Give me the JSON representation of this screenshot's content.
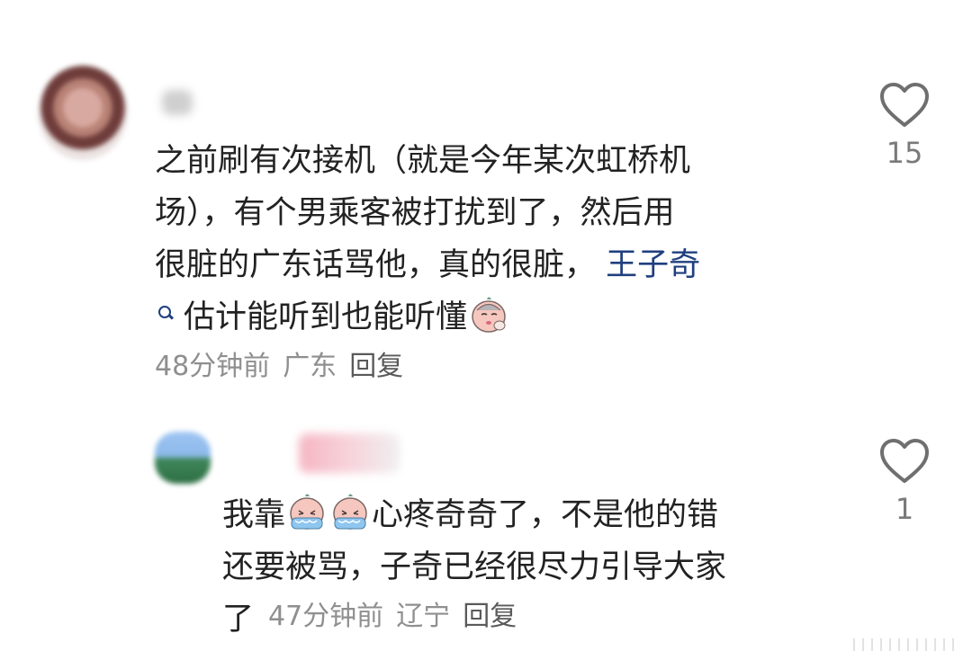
{
  "comments": [
    {
      "text_lines": [
        "之前刷有次接机（就是今年某次虹桥机",
        "场），有个男乘客被打扰到了，然后用",
        "很脏的广东话骂他，真的很脏，"
      ],
      "mention": "王子奇",
      "tail_text": "估计能听到也能听懂",
      "time": "48分钟前",
      "location": "广东",
      "reply_label": "回复",
      "like_count": "15",
      "emoji_name": "sad-face-emoji"
    },
    {
      "prefix": "我靠",
      "middle": "心疼奇奇了，不是他的错",
      "line2": "还要被骂，子奇已经很尽力引导大家",
      "line3": "了",
      "time": "47分钟前",
      "location": "辽宁",
      "reply_label": "回复",
      "like_count": "1",
      "emoji_name": "crying-face-emoji"
    }
  ],
  "colors": {
    "mention": "#1f3f7f",
    "meta": "#8f8f8f",
    "text": "#222222"
  }
}
